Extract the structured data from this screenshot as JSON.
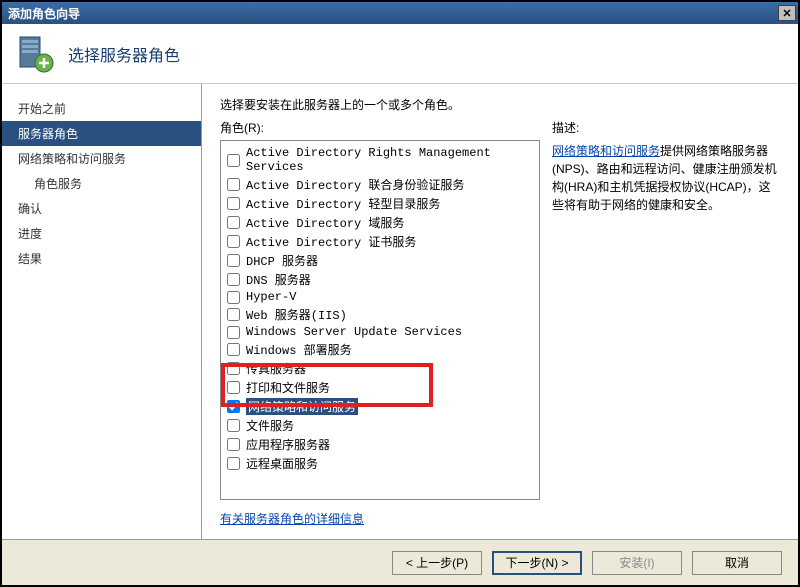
{
  "window": {
    "title": "添加角色向导"
  },
  "header": {
    "title": "选择服务器角色"
  },
  "sidebar": {
    "items": [
      {
        "label": "开始之前",
        "selected": false,
        "indent": false
      },
      {
        "label": "服务器角色",
        "selected": true,
        "indent": false
      },
      {
        "label": "网络策略和访问服务",
        "selected": false,
        "indent": false
      },
      {
        "label": "角色服务",
        "selected": false,
        "indent": true
      },
      {
        "label": "确认",
        "selected": false,
        "indent": false
      },
      {
        "label": "进度",
        "selected": false,
        "indent": false
      },
      {
        "label": "结果",
        "selected": false,
        "indent": false
      }
    ]
  },
  "main": {
    "instruction": "选择要安装在此服务器上的一个或多个角色。",
    "roles_label": "角色(R):",
    "roles": [
      {
        "label": "Active Directory Rights Management Services",
        "checked": false
      },
      {
        "label": "Active Directory 联合身份验证服务",
        "checked": false
      },
      {
        "label": "Active Directory 轻型目录服务",
        "checked": false
      },
      {
        "label": "Active Directory 域服务",
        "checked": false
      },
      {
        "label": "Active Directory 证书服务",
        "checked": false
      },
      {
        "label": "DHCP 服务器",
        "checked": false
      },
      {
        "label": "DNS 服务器",
        "checked": false
      },
      {
        "label": "Hyper-V",
        "checked": false
      },
      {
        "label": "Web 服务器(IIS)",
        "checked": false
      },
      {
        "label": "Windows Server Update Services",
        "checked": false
      },
      {
        "label": "Windows 部署服务",
        "checked": false
      },
      {
        "label": "传真服务器",
        "checked": false
      },
      {
        "label": "打印和文件服务",
        "checked": false
      },
      {
        "label": "网络策略和访问服务",
        "checked": true,
        "selected": true
      },
      {
        "label": "文件服务",
        "checked": false
      },
      {
        "label": "应用程序服务器",
        "checked": false
      },
      {
        "label": "远程桌面服务",
        "checked": false
      }
    ],
    "desc_label": "描述:",
    "desc_link": "网络策略和访问服务",
    "desc_text": "提供网络策略服务器(NPS)、路由和远程访问、健康注册颁发机构(HRA)和主机凭据授权协议(HCAP)，这些将有助于网络的健康和安全。",
    "more_link": "有关服务器角色的详细信息"
  },
  "footer": {
    "prev": "< 上一步(P)",
    "next": "下一步(N) >",
    "install": "安装(I)",
    "cancel": "取消"
  }
}
